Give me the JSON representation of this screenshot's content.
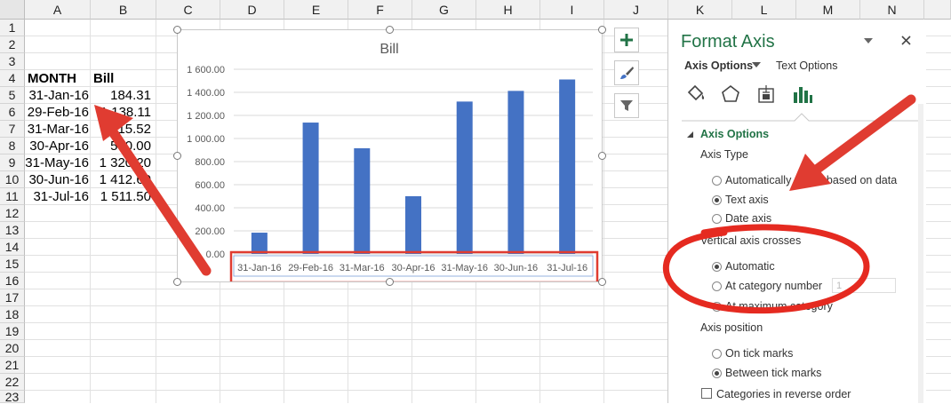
{
  "columns": [
    "A",
    "B",
    "C",
    "D",
    "E",
    "F",
    "G",
    "H",
    "I",
    "J",
    "K",
    "L",
    "M",
    "N"
  ],
  "rows": [
    "1",
    "2",
    "3",
    "4",
    "5",
    "6",
    "7",
    "8",
    "9",
    "10",
    "11",
    "12",
    "13",
    "14",
    "15",
    "16",
    "17",
    "18",
    "19",
    "20",
    "21",
    "22",
    "23"
  ],
  "sheet": {
    "header_month": "MONTH",
    "header_bill": "Bill",
    "data": [
      {
        "month": "31-Jan-16",
        "bill": "184.31"
      },
      {
        "month": "29-Feb-16",
        "bill": "1 138.11"
      },
      {
        "month": "31-Mar-16",
        "bill": "915.52"
      },
      {
        "month": "30-Apr-16",
        "bill": "500.00"
      },
      {
        "month": "31-May-16",
        "bill": "1 320.20"
      },
      {
        "month": "30-Jun-16",
        "bill": "1 412.60"
      },
      {
        "month": "31-Jul-16",
        "bill": "1 511.50"
      }
    ]
  },
  "chart_data": {
    "type": "bar",
    "title": "Bill",
    "categories": [
      "31-Jan-16",
      "29-Feb-16",
      "31-Mar-16",
      "30-Apr-16",
      "31-May-16",
      "30-Jun-16",
      "31-Jul-16"
    ],
    "values": [
      184.31,
      1138.11,
      915.52,
      500.0,
      1320.2,
      1412.6,
      1511.5
    ],
    "ylim": [
      0,
      1600
    ],
    "yticks": [
      "0.00",
      "200.00",
      "400.00",
      "600.00",
      "800.00",
      "1 000.00",
      "1 200.00",
      "1 400.00",
      "1 600.00"
    ],
    "grid": true,
    "color": "#4472c4"
  },
  "panel": {
    "title": "Format Axis",
    "tab_axis_options": "Axis Options",
    "tab_text_options": "Text Options",
    "section_axis_options": "Axis Options",
    "axis_type_label": "Axis Type",
    "opt_auto": "Automatically select based on data",
    "opt_text_axis": "Text axis",
    "opt_date_axis": "Date axis",
    "vac_label": "Vertical axis crosses",
    "opt_automatic": "Automatic",
    "opt_at_category": "At category number",
    "category_number_value": "1",
    "opt_at_max": "At maximum category",
    "axis_position_label": "Axis position",
    "opt_on_tick": "On tick marks",
    "opt_between_tick": "Between tick marks",
    "reverse_label": "Categories in reverse order"
  },
  "colors": {
    "accent": "#217346",
    "bar": "#4472c4",
    "annotation": "#e03c31"
  }
}
